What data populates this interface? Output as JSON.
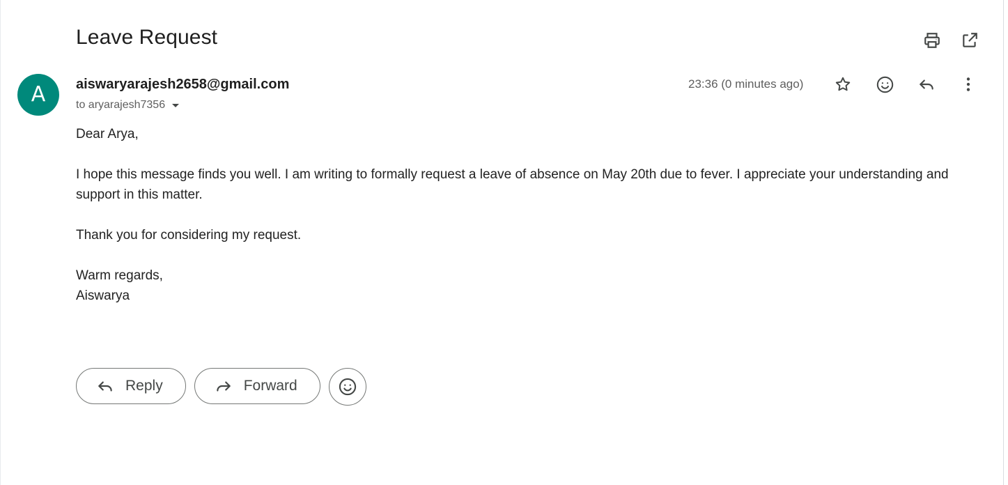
{
  "email": {
    "subject": "Leave Request",
    "avatar_letter": "A",
    "sender": "aiswaryarajesh2658@gmail.com",
    "recipient": "to aryarajesh7356",
    "timestamp": "23:36 (0 minutes ago)",
    "body": {
      "greeting": "Dear Arya,",
      "paragraph1": "I hope this message finds you well. I am writing to formally request a leave of absence on May 20th due to fever. I appreciate your understanding and support in this matter.",
      "paragraph2": "Thank you for considering my request.",
      "closing": "Warm regards,",
      "signature": "Aiswarya"
    }
  },
  "actions": {
    "reply_label": "Reply",
    "forward_label": "Forward"
  },
  "icons": {
    "top": [
      "print-icon",
      "open-in-new-window-icon"
    ],
    "header": [
      "star-icon",
      "emoji-reaction-icon",
      "reply-icon",
      "more-vert-icon"
    ],
    "buttons": [
      "reply-arrow-icon",
      "forward-arrow-icon",
      "emoji-icon"
    ]
  },
  "colors": {
    "avatar_bg": "#00897b",
    "text": "#1f1f1f",
    "muted": "#5e5e5e",
    "border": "#747775"
  }
}
